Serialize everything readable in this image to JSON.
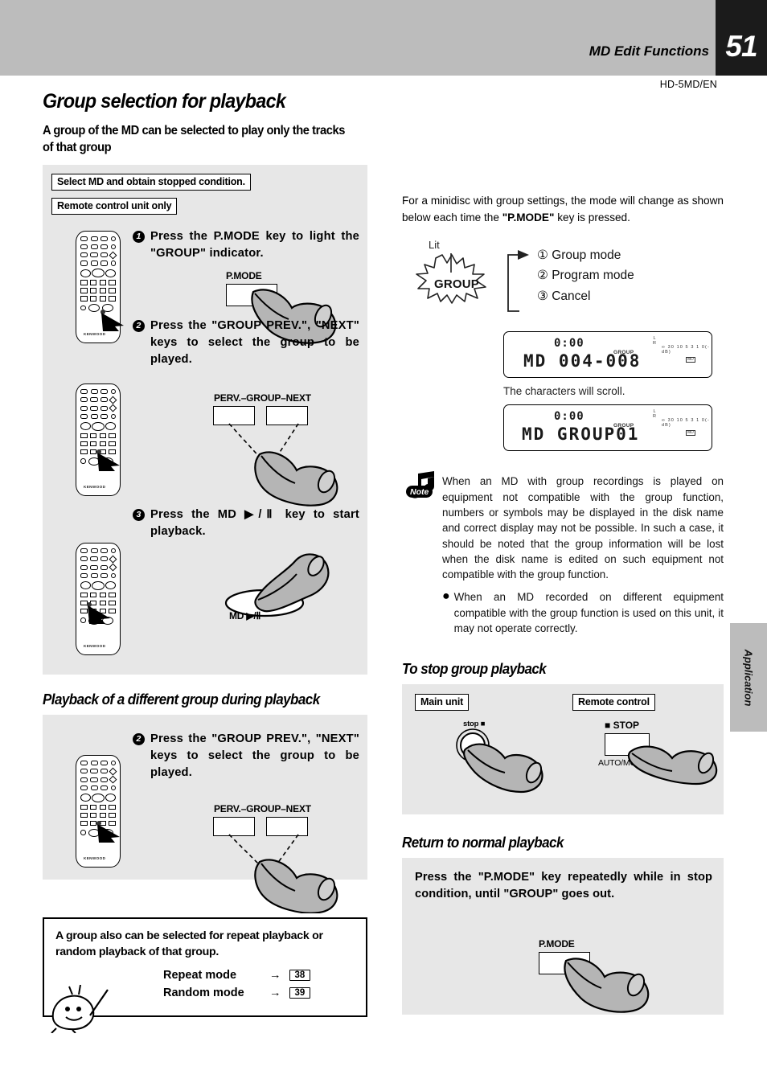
{
  "header": {
    "section": "MD Edit Functions",
    "page_number": "51",
    "model": "HD-5MD/EN",
    "side_tab": "Application"
  },
  "title": "Group selection for playback",
  "subtitle": "A group of the MD can be selected to play only the tracks of that group",
  "left_panel": {
    "tag1": "Select MD and obtain stopped condition.",
    "tag2": "Remote control unit only",
    "steps": [
      {
        "num": "1",
        "text": "Press the P.MODE key to light the \"GROUP\" indicator.",
        "key_label": "P.MODE"
      },
      {
        "num": "2",
        "text": "Press the \"GROUP PREV.\", \"NEXT\" keys to select the group to be played.",
        "key_label": "PERV.–GROUP–NEXT"
      },
      {
        "num": "3",
        "text": "Press the MD ▶/Ⅱ key to start playback.",
        "key_label": "MD ▶/Ⅱ"
      }
    ],
    "remote_brand": "KENWOOD"
  },
  "right_intro": {
    "text_parts": [
      "For a minidisc with group settings, the mode will change as shown below each time the ",
      "\"P.MODE\"",
      " key is pressed."
    ],
    "lit_label": "Lit",
    "group_burst": "GROUP",
    "modes": [
      {
        "num": "①",
        "label": "Group mode"
      },
      {
        "num": "②",
        "label": "Program mode"
      },
      {
        "num": "③",
        "label": "Cancel"
      }
    ]
  },
  "lcd1": {
    "time": "0:00",
    "main": "MD 004-008",
    "group_label": "GROUP",
    "lr_l": "L",
    "lr_r": "R",
    "scale": "∞ 30 10 5 3 1 0(-dB)",
    "md_icon": "MD",
    "caption": "The characters will scroll."
  },
  "lcd2": {
    "time": "0:00",
    "main": "MD GROUP01",
    "group_label": "GROUP",
    "lr_l": "L",
    "lr_r": "R",
    "scale": "∞ 30 10 5 3 1 0(-dB)",
    "md_icon": "MD"
  },
  "note": {
    "icon_label": "Note",
    "body": "When an MD with group recordings is played on equipment not compatible with the group function, numbers or symbols may be displayed in the disk name and correct display may not be possible. In such a case, it should be noted that the group information will be lost when the disk name is edited on such equipment not compatible with the group function.",
    "bullet": "When an MD recorded on different equipment compatible with the group function is used on this unit, it may not operate correctly."
  },
  "section_playback_diff": {
    "heading": "Playback of a different group during playback",
    "step": {
      "num": "2",
      "text": "Press the \"GROUP PREV.\", \"NEXT\" keys to select the group to be played.",
      "key_label": "PERV.–GROUP–NEXT"
    }
  },
  "repeat_box": {
    "text": "A group also can be selected for repeat playback or random playback of that group.",
    "rows": [
      {
        "label": "Repeat mode",
        "arrow": "→",
        "page": "38"
      },
      {
        "label": "Random mode",
        "arrow": "→",
        "page": "39"
      }
    ]
  },
  "section_stop": {
    "heading": "To stop group playback",
    "tag_main": "Main unit",
    "tag_remote": "Remote control",
    "main_key": "stop",
    "remote_key": "STOP",
    "remote_sub": "AUTO/MONO"
  },
  "section_return": {
    "heading": "Return to normal playback",
    "text": "Press the \"P.MODE\" key repeatedly while in stop condition, until \"GROUP\" goes out.",
    "key_label": "P.MODE"
  },
  "colors": {
    "header_band": "#bcbcbc",
    "page_block": "#1b1b1b",
    "panel_gray": "#e7e7e7",
    "hand_gray": "#b5b5b5"
  }
}
